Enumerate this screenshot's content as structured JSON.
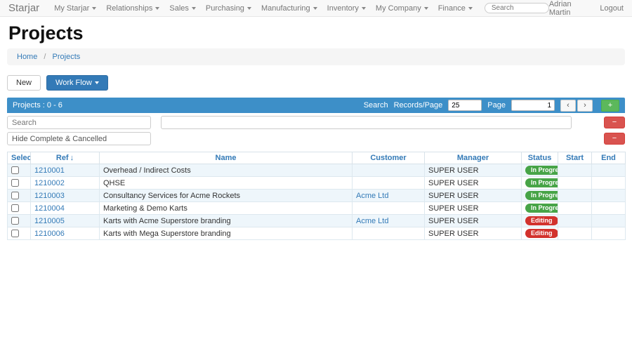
{
  "navbar": {
    "brand": "Starjar",
    "items": [
      {
        "label": "My Starjar"
      },
      {
        "label": "Relationships"
      },
      {
        "label": "Sales"
      },
      {
        "label": "Purchasing"
      },
      {
        "label": "Manufacturing"
      },
      {
        "label": "Inventory"
      },
      {
        "label": "My Company"
      },
      {
        "label": "Finance"
      }
    ],
    "search_placeholder": "Search",
    "user": "Adrian Martin",
    "logout_label": "Logout"
  },
  "page": {
    "title": "Projects",
    "breadcrumb": {
      "home": "Home",
      "separator": "/",
      "current": "Projects"
    }
  },
  "toolbar": {
    "new_label": "New",
    "workflow_label": "Work Flow"
  },
  "panel": {
    "title": "Projects : 0 - 6",
    "search_label": "Search",
    "records_per_page_label": "Records/Page",
    "records_per_page_value": "25",
    "page_label": "Page",
    "page_value": "1",
    "prev_label": "‹",
    "next_label": "›",
    "add_label": "+"
  },
  "filters": {
    "search_placeholder": "Search",
    "filter_value": "",
    "status_filter_value": "Hide Complete & Cancelled",
    "remove_label": "−"
  },
  "table": {
    "columns": [
      {
        "label": "Select"
      },
      {
        "label": "Ref",
        "sort_icon": "↓"
      },
      {
        "label": "Name"
      },
      {
        "label": "Customer"
      },
      {
        "label": "Manager"
      },
      {
        "label": "Status"
      },
      {
        "label": "Start"
      },
      {
        "label": "End"
      }
    ],
    "rows": [
      {
        "ref": "1210001",
        "name": "Overhead / Indirect Costs",
        "customer": "",
        "manager": "SUPER USER",
        "status": "In Progress",
        "status_color": "green",
        "start": "",
        "end": ""
      },
      {
        "ref": "1210002",
        "name": "QHSE",
        "customer": "",
        "manager": "SUPER USER",
        "status": "In Progress",
        "status_color": "green",
        "start": "",
        "end": ""
      },
      {
        "ref": "1210003",
        "name": "Consultancy Services for Acme Rockets",
        "customer": "Acme Ltd",
        "manager": "SUPER USER",
        "status": "In Progress",
        "status_color": "green",
        "start": "",
        "end": ""
      },
      {
        "ref": "1210004",
        "name": "Marketing & Demo Karts",
        "customer": "",
        "manager": "SUPER USER",
        "status": "In Progress",
        "status_color": "green",
        "start": "",
        "end": ""
      },
      {
        "ref": "1210005",
        "name": "Karts with Acme Superstore branding",
        "customer": "Acme Ltd",
        "manager": "SUPER USER",
        "status": "Editing",
        "status_color": "red",
        "start": "",
        "end": ""
      },
      {
        "ref": "1210006",
        "name": "Karts with Mega Superstore branding",
        "customer": "",
        "manager": "SUPER USER",
        "status": "Editing",
        "status_color": "red",
        "start": "",
        "end": ""
      }
    ]
  },
  "colors": {
    "green": "#47a447",
    "red": "#d2322d",
    "panel_blue": "#3d8fc8",
    "link_blue": "#337ab7"
  }
}
